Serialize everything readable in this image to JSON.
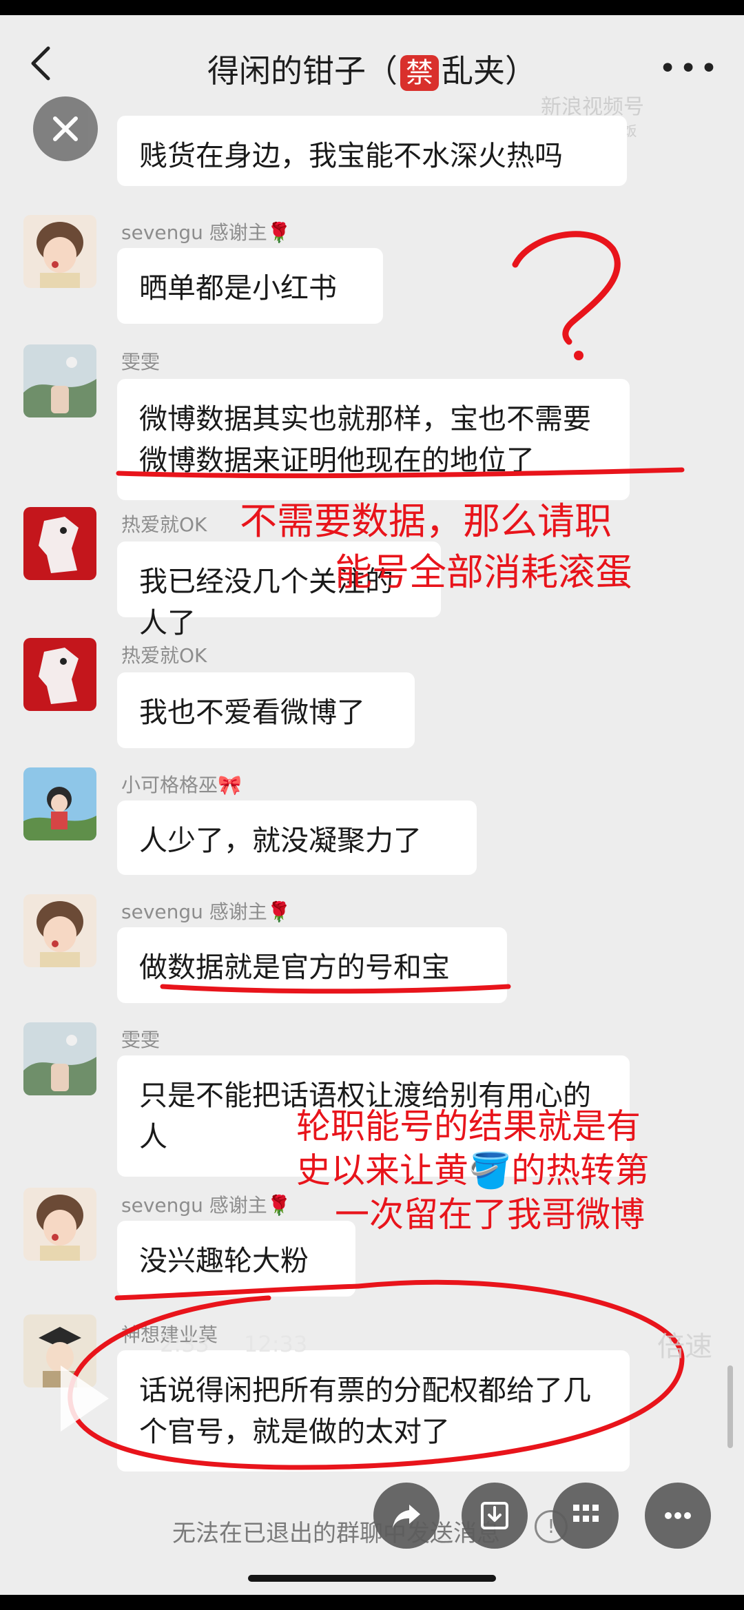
{
  "header": {
    "title_prefix": "得闲的钳子（",
    "title_tag": "禁",
    "title_suffix": "乱夹）",
    "more_icon": "more-horizontal-icon",
    "back_icon": "back-arrow-icon"
  },
  "watermark": {
    "text": "新浪视频号",
    "sub": "@cu饭饭"
  },
  "messages": [
    {
      "nick": "",
      "text": "贱货在身边，我宝能不水深火热吗"
    },
    {
      "nick": "sevengu 感谢主🌹",
      "text": "晒单都是小红书"
    },
    {
      "nick": "雯雯",
      "text": "微博数据其实也就那样，宝也不需要微博数据来证明他现在的地位了"
    },
    {
      "nick": "热爱就OK",
      "text": "我已经没几个关注的人了"
    },
    {
      "nick": "热爱就OK",
      "text": "我也不爱看微博了"
    },
    {
      "nick": "小可格格巫🎀",
      "text": "人少了，就没凝聚力了"
    },
    {
      "nick": "sevengu 感谢主🌹",
      "text": "做数据就是官方的号和宝"
    },
    {
      "nick": "雯雯",
      "text": "只是不能把话语权让渡给别有用心的人"
    },
    {
      "nick": "sevengu 感谢主🌹",
      "text": "没兴趣轮大粉"
    },
    {
      "nick": "神想建业莫",
      "text": "话说得闲把所有票的分配权都给了几个官号，就是做的太对了"
    }
  ],
  "annotations": {
    "question": "?",
    "note1_line1": "不需要数据，那么请职",
    "note1_line2": "能号全部消耗滚蛋",
    "note2_line1": "轮职能号的结果就是有",
    "note2_line2": "史以来让黄🪣的热转第",
    "note2_line3": "一次留在了我哥微博"
  },
  "video": {
    "current_time": "2:33",
    "total_time": "12:33",
    "speed_label": "倍速"
  },
  "footer": {
    "notice": "无法在已退出的群聊中发送消息",
    "info_icon": "!"
  },
  "actions": [
    "share-icon",
    "download-icon",
    "grid-icon",
    "more-icon"
  ],
  "colors": {
    "annotation_red": "#e8141b",
    "background": "#ededed",
    "bubble": "#ffffff"
  }
}
